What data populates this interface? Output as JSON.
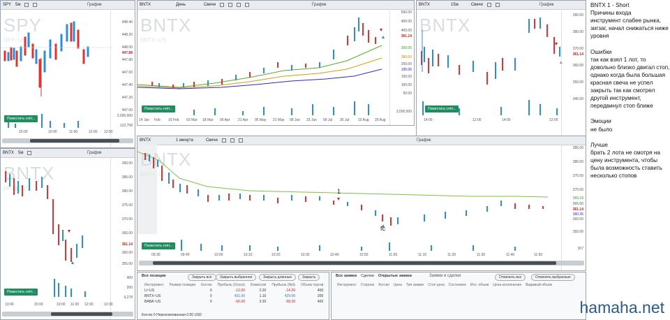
{
  "note": {
    "text": "BNTX 1 - Short\nПричины входа\nинструмент слабее рынка, зигзаг, начал снижаться ниже уровня\n\nОшибки\nтак как взял 1 лот, то довольно близко двигал стоп, однако когда была большая красная свеча не успел закрыть так как смотрел другой инструмент, передвинул стоп ближе\n\nЭмоции\nне было\n\nЛучше\nбрать 2 лота не смотря на цену инструмента, чтобы была возможность ставить несколько стопов"
  },
  "brand": "hamaha.net",
  "common": {
    "chart_title": "График",
    "place_order": "Поместить счёт..."
  },
  "charts": {
    "spy": {
      "symbol": "SPY",
      "interval": "5м",
      "watermark": "SPY",
      "watermark_sub": "SPY~US",
      "yticks": [
        "448.40",
        "448.20",
        "448.00",
        "447.80",
        "447.60",
        "447.40",
        "447.20",
        "447.00"
      ],
      "price_label": "447.89",
      "volume_ticks": [
        "2,000,000",
        "122,758"
      ],
      "xticks": [
        "15:00",
        "10:00",
        "11:00",
        "12:00",
        "12:50"
      ]
    },
    "daily": {
      "symbol": "BNTX",
      "interval": "День",
      "chart_type": "Свечи",
      "watermark": "BNTX",
      "watermark_sub": "BNTX~US",
      "yticks": [
        "500.00",
        "450.00",
        "400.00",
        "350.00",
        "300.00",
        "250.00",
        "200.00",
        "150.00",
        "100.00",
        "50.00"
      ],
      "price_labels": [
        "361.14",
        "300.05",
        "280.60",
        "250.07",
        "195.06"
      ],
      "volume_ticks": [
        "3,000,000"
      ],
      "xticks": [
        "14 Jan",
        "Feb",
        "16 Feb",
        "03 Mar",
        "18 Mar",
        "06 Apr",
        "21 Apr",
        "06 May",
        "21 May",
        "08 Jun",
        "23 Jun",
        "09 Jul",
        "26 Jul",
        "10 Aug",
        "25 Aug"
      ]
    },
    "m15": {
      "symbol": "BNTX",
      "interval": "15м",
      "chart_type": "Свечи",
      "watermark": "BNTX",
      "yticks": [
        "390.00",
        "380.00",
        "370.00",
        "360.00",
        "350.00",
        "340.00"
      ],
      "price_label": "361.14",
      "xticks": [
        "14:00",
        "12:00",
        "14:00",
        "12:00"
      ]
    },
    "m5": {
      "symbol": "BNTX",
      "interval": "5м",
      "watermark": "BNTX",
      "watermark_sub": "BNTX~US",
      "yticks": [
        "390.00",
        "385.00",
        "380.00",
        "375.00",
        "370.00",
        "365.00",
        "360.00",
        "355.00"
      ],
      "price_label": "361.14",
      "volume_ticks": [
        "400",
        "200",
        "9,278"
      ],
      "xticks": [
        "13:00",
        "15:00",
        "10:00",
        "11:00",
        "12:00",
        "13:30"
      ]
    },
    "m1": {
      "symbol": "BNTX",
      "interval": "1 минута",
      "chart_type": "Свечи",
      "watermark": "BNTX",
      "watermark_sub": "BNTX~US",
      "yticks": [
        "385.00",
        "380.00",
        "375.00",
        "370.00",
        "365.00",
        "360.00",
        "355.00"
      ],
      "price_labels": [
        "365.18",
        "361.14",
        "360.35"
      ],
      "volume_ticks": [
        "307"
      ],
      "xticks": [
        "09:30",
        "09:40",
        "10:00",
        "10:10",
        "10:20",
        "10:30",
        "10:40",
        "10:50",
        "11:00",
        "11:10",
        "11:20",
        "11:30",
        "11:40",
        "11:50"
      ],
      "annot_entry": "1",
      "annot_exit": "fc"
    }
  },
  "positions": {
    "tabs": [
      "Все позиции",
      "Сделки"
    ],
    "buttons": [
      "Закрыть все",
      "Закрыть выбранное",
      "Закрыть длинные",
      "Закрыть"
    ],
    "columns": [
      "Инструмент",
      "Размер позиции",
      "Кол-во",
      "Прибыль (Gross)",
      "Комиссия",
      "Прибыль (Net)",
      "Объем торгов"
    ],
    "rows": [
      [
        "LI~US",
        "0",
        "-12.00",
        "2.20",
        "-14.20",
        "400"
      ],
      [
        "BNTX~US",
        "0",
        "431.00",
        "1.10",
        "429.90",
        "200"
      ],
      [
        "BABA~US",
        "0",
        "-56.00",
        "2.20",
        "-58.20",
        "400"
      ]
    ],
    "footer": "Кол-во 0   Нереализованная 0.00 USD"
  },
  "orders": {
    "title": "Заявки и сделки",
    "tabs": [
      "Все заявки",
      "Сделки",
      "Открытые заявки"
    ],
    "buttons": [
      "Отменить все",
      "Отменить выбранные"
    ],
    "columns": [
      "Инструмент",
      "Сторона",
      "Кол-во",
      "Цена",
      "Тип заявки",
      "Стоп цена",
      "Состояние",
      "Исп. объем",
      "Цена исполнения",
      "Видимый объем"
    ]
  }
}
